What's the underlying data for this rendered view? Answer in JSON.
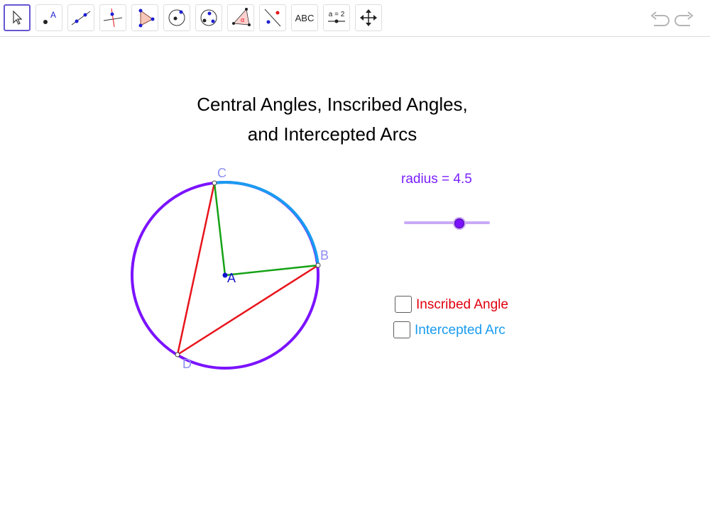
{
  "toolbar": {
    "tools": [
      {
        "name": "move-tool",
        "active": true
      },
      {
        "name": "point-tool",
        "glyph": "A"
      },
      {
        "name": "line-tool"
      },
      {
        "name": "perpendicular-line-tool"
      },
      {
        "name": "polygon-tool"
      },
      {
        "name": "circle-center-point-tool"
      },
      {
        "name": "circle-three-points-tool"
      },
      {
        "name": "angle-tool",
        "glyph": "α"
      },
      {
        "name": "reflect-tool"
      },
      {
        "name": "text-tool",
        "label": "ABC"
      },
      {
        "name": "slider-tool",
        "label": "a = 2"
      },
      {
        "name": "move-graphics-view-tool"
      }
    ],
    "undo": "undo-icon",
    "redo": "redo-icon"
  },
  "title": {
    "line1": "Central Angles, Inscribed Angles,",
    "line2": "and Intercepted Arcs"
  },
  "slider": {
    "label": "radius = 4.5",
    "name": "radius",
    "value": 4.5,
    "fraction": 0.64
  },
  "checkboxes": [
    {
      "label": "Inscribed Angle",
      "checked": false,
      "color": "#e0000e"
    },
    {
      "label": "Intercepted Arc",
      "checked": false,
      "color": "#1a9bf0"
    }
  ],
  "points": {
    "A": "A",
    "B": "B",
    "C": "C",
    "D": "D"
  },
  "colors": {
    "circle": "#7b13ff",
    "arc": "#1a9bf0",
    "central_angle_segments": "#16a216",
    "inscribed_angle_segments": "#e8141c",
    "point_label": "#8d8df0",
    "center_label": "#1010d0"
  }
}
